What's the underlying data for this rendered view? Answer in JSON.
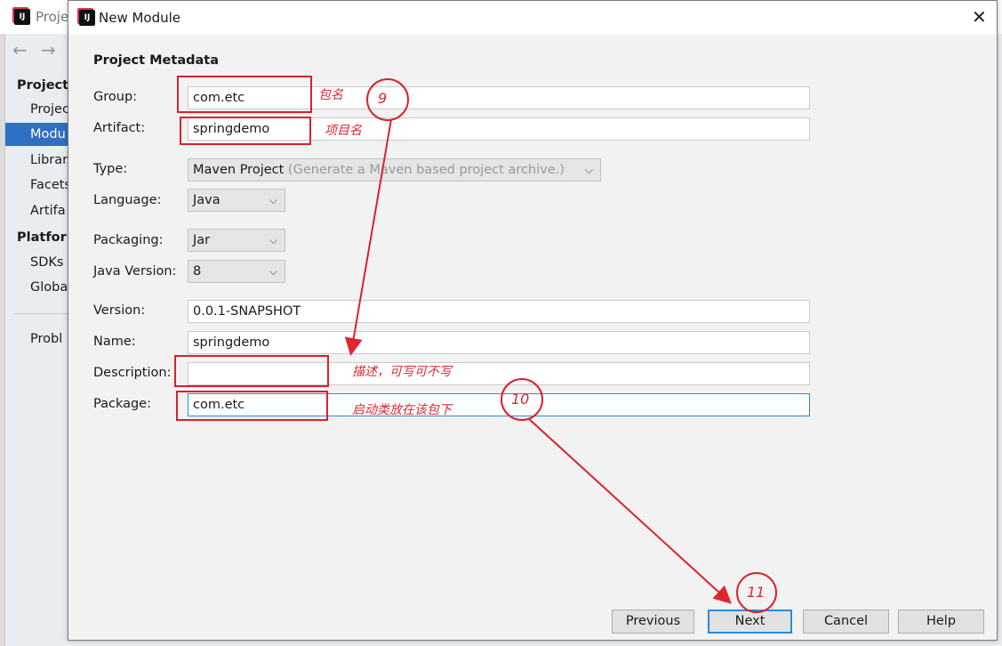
{
  "background_window": {
    "title": "Proje",
    "sidebar": [
      {
        "label": "Project",
        "kind": "header"
      },
      {
        "label": "Projec",
        "kind": "item"
      },
      {
        "label": "Modu",
        "kind": "item",
        "selected": true
      },
      {
        "label": "Librar",
        "kind": "item"
      },
      {
        "label": "Facets",
        "kind": "item"
      },
      {
        "label": "Artifa",
        "kind": "item"
      },
      {
        "label": "Platforn",
        "kind": "header"
      },
      {
        "label": "SDKs",
        "kind": "item"
      },
      {
        "label": "Globa",
        "kind": "item"
      },
      {
        "label": "Probl",
        "kind": "item"
      }
    ]
  },
  "dialog": {
    "title": "New Module",
    "section": "Project Metadata",
    "fields": {
      "group": {
        "label": "Group:",
        "value": "com.etc"
      },
      "artifact": {
        "label": "Artifact:",
        "value": "springdemo"
      },
      "type": {
        "label": "Type:",
        "value": "Maven Project",
        "hint": "(Generate a Maven based project archive.)"
      },
      "language": {
        "label": "Language:",
        "value": "Java"
      },
      "packaging": {
        "label": "Packaging:",
        "value": "Jar"
      },
      "java_version": {
        "label": "Java Version:",
        "value": "8"
      },
      "version": {
        "label": "Version:",
        "value": "0.0.1-SNAPSHOT"
      },
      "name": {
        "label": "Name:",
        "value": "springdemo"
      },
      "description": {
        "label": "Description:",
        "value": ""
      },
      "package": {
        "label": "Package:",
        "value": "com.etc"
      }
    },
    "buttons": {
      "previous": "Previous",
      "next": "Next",
      "cancel": "Cancel",
      "help": "Help"
    }
  },
  "annotations": {
    "group_note": "包名",
    "artifact_note": "项目名",
    "description_note": "描述，可写可不写",
    "package_note": "启动类放在该包下",
    "step_9": "9",
    "step_10": "10",
    "step_11": "11",
    "color": "#e0262e"
  },
  "colors": {
    "selection": "#2f6fc4",
    "focus": "#2b8ad8",
    "dialog_bg": "#f2f2f2"
  }
}
